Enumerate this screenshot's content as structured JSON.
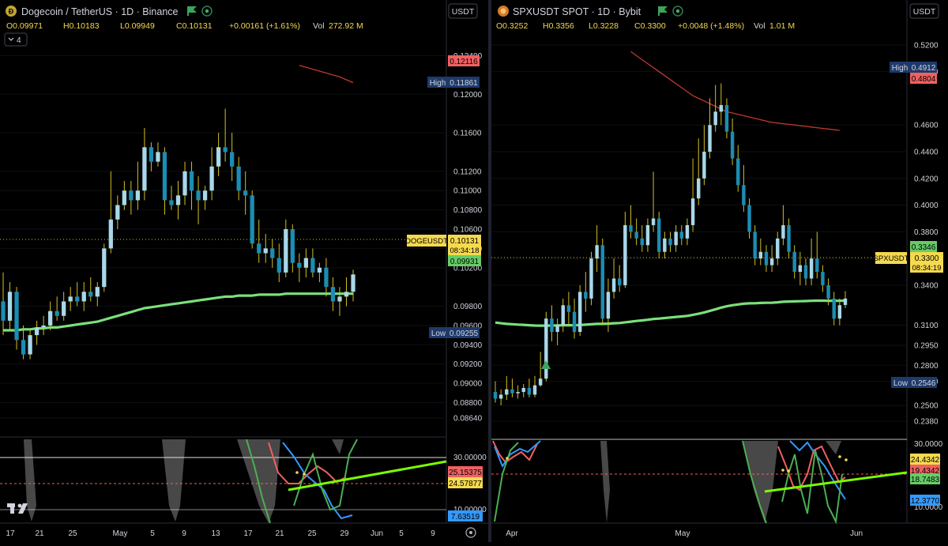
{
  "colors": {
    "bull": "#a8d8ea",
    "bear": "#1b8db3",
    "wick": "#d4c020",
    "ema": "#7be07b",
    "ma_red": "#c0392b",
    "panel_bg": "#000000",
    "border": "#2a2e39",
    "price_text": "#d1d4dc",
    "tag_yellow": "#f5d94e",
    "tag_red": "#f06060",
    "tag_green": "#66cc66",
    "tag_navy": "#1e3a6a",
    "osc_green": "#4caf50",
    "osc_red": "#f06060",
    "osc_blue": "#3399ff",
    "osc_trend": "#7cfc00",
    "osc_gray": "#555555"
  },
  "left": {
    "symbol_icon": "dogecoin-coin-icon",
    "title": "Dogecoin / TetherUS · 1D · Binance",
    "ohlc": {
      "o": "O0.09971",
      "h": "H0.10183",
      "l": "L0.09949",
      "c": "C0.10131",
      "chg": "+0.00161 (+1.61%)",
      "vol_label": "Vol",
      "vol": "272.92 M"
    },
    "collapse_label": "4",
    "currency": "USDT",
    "price_labels": [
      "0.12400",
      "0.12000",
      "0.11600",
      "0.11200",
      "0.11000",
      "0.10800",
      "0.10600",
      "0.10400",
      "0.10200",
      "0.09800",
      "0.09600",
      "0.09400",
      "0.09200",
      "0.09000",
      "0.08800",
      "0.08640"
    ],
    "tags": {
      "ma_red": "0.12116",
      "high_label": "High",
      "high": "0.11861",
      "symbol": "DOGEUSDT",
      "last": "0.10131",
      "countdown": "08:34:18",
      "ema": "0.09931",
      "low_label": "Low",
      "low": "0.09255"
    },
    "osc": {
      "levels": [
        "30.00000",
        "10.00000"
      ],
      "tags": {
        "red": "25.15375",
        "yellow": "24.57877",
        "blue": "7.63519"
      }
    },
    "x_labels": [
      "17",
      "21",
      "25",
      "May",
      "5",
      "9",
      "13",
      "17",
      "21",
      "25",
      "29",
      "Jun",
      "5",
      "9"
    ],
    "logo": "TV"
  },
  "right": {
    "symbol_icon": "spx-coin-icon",
    "title": "SPXUSDT SPOT · 1D · Bybit",
    "ohlc": {
      "o": "O0.3252",
      "h": "H0.3356",
      "l": "L0.3228",
      "c": "C0.3300",
      "chg": "+0.0048 (+1.48%)",
      "vol_label": "Vol",
      "vol": "1.01 M"
    },
    "currency": "USDT",
    "price_labels": [
      "0.5200",
      "0.5000",
      "0.4600",
      "0.4400",
      "0.4200",
      "0.4000",
      "0.3800",
      "0.3600",
      "0.3400",
      "0.3100",
      "0.2950",
      "0.2800",
      "0.2680",
      "0.2500",
      "0.2380"
    ],
    "tags": {
      "high_label": "High",
      "high": "0.4912",
      "ma_red": "0.4804",
      "ema": "0.3346",
      "symbol": "SPXUSDT",
      "last": "0.3300",
      "countdown": "08:34:19",
      "low_label": "Low",
      "low": "0.2546"
    },
    "osc": {
      "levels": [
        "30.0000",
        "10.0000"
      ],
      "tags": {
        "yellow": "24.4342",
        "red": "19.4342",
        "green": "18.7483",
        "blue": "12.3770"
      }
    },
    "x_labels": [
      "Apr",
      "May",
      "Jun"
    ]
  },
  "chart_data": [
    {
      "type": "candlestick",
      "title": "Dogecoin / TetherUS · 1D · Binance",
      "ylim": [
        0.0855,
        0.1265
      ],
      "ohlc": [
        [
          0.0985,
          0.1015,
          0.095,
          0.0965
        ],
        [
          0.0965,
          0.1005,
          0.0955,
          0.0995
        ],
        [
          0.0995,
          0.1,
          0.0935,
          0.0945
        ],
        [
          0.0945,
          0.096,
          0.0925,
          0.093
        ],
        [
          0.093,
          0.0955,
          0.0925,
          0.095
        ],
        [
          0.095,
          0.0965,
          0.094,
          0.0958
        ],
        [
          0.0958,
          0.097,
          0.095,
          0.096
        ],
        [
          0.096,
          0.0985,
          0.0955,
          0.0975
        ],
        [
          0.0975,
          0.099,
          0.0965,
          0.097
        ],
        [
          0.097,
          0.0995,
          0.0965,
          0.0985
        ],
        [
          0.0985,
          0.1,
          0.0975,
          0.099
        ],
        [
          0.099,
          0.1005,
          0.098,
          0.0985
        ],
        [
          0.0985,
          0.1005,
          0.0975,
          0.0995
        ],
        [
          0.0995,
          0.101,
          0.0985,
          0.099
        ],
        [
          0.099,
          0.1005,
          0.098,
          0.1
        ],
        [
          0.1,
          0.1045,
          0.0995,
          0.104
        ],
        [
          0.104,
          0.112,
          0.1035,
          0.107
        ],
        [
          0.107,
          0.1095,
          0.106,
          0.1085
        ],
        [
          0.1085,
          0.111,
          0.108,
          0.11
        ],
        [
          0.11,
          0.111,
          0.1075,
          0.109
        ],
        [
          0.109,
          0.113,
          0.108,
          0.11
        ],
        [
          0.11,
          0.1165,
          0.109,
          0.1145
        ],
        [
          0.1145,
          0.115,
          0.112,
          0.113
        ],
        [
          0.113,
          0.115,
          0.1125,
          0.114
        ],
        [
          0.114,
          0.1145,
          0.1075,
          0.109
        ],
        [
          0.109,
          0.1105,
          0.108,
          0.1085
        ],
        [
          0.1085,
          0.111,
          0.107,
          0.1095
        ],
        [
          0.1095,
          0.113,
          0.1085,
          0.112
        ],
        [
          0.112,
          0.113,
          0.108,
          0.11
        ],
        [
          0.11,
          0.1115,
          0.1065,
          0.109
        ],
        [
          0.109,
          0.1105,
          0.108,
          0.11
        ],
        [
          0.11,
          0.1145,
          0.109,
          0.1125
        ],
        [
          0.1125,
          0.116,
          0.1115,
          0.1145
        ],
        [
          0.1145,
          0.1185,
          0.113,
          0.114
        ],
        [
          0.114,
          0.116,
          0.111,
          0.1125
        ],
        [
          0.1125,
          0.1135,
          0.109,
          0.11
        ],
        [
          0.11,
          0.112,
          0.1075,
          0.1095
        ],
        [
          0.1095,
          0.11,
          0.104,
          0.1045
        ],
        [
          0.1045,
          0.107,
          0.1025,
          0.1035
        ],
        [
          0.1035,
          0.1055,
          0.1025,
          0.104
        ],
        [
          0.104,
          0.105,
          0.102,
          0.103
        ],
        [
          0.103,
          0.1045,
          0.1005,
          0.1015
        ],
        [
          0.1015,
          0.107,
          0.101,
          0.106
        ],
        [
          0.106,
          0.1065,
          0.1015,
          0.1025
        ],
        [
          0.1025,
          0.1035,
          0.1005,
          0.102
        ],
        [
          0.102,
          0.104,
          0.101,
          0.103
        ],
        [
          0.103,
          0.104,
          0.101,
          0.1015
        ],
        [
          0.1015,
          0.1025,
          0.1005,
          0.102
        ],
        [
          0.102,
          0.103,
          0.099,
          0.1
        ],
        [
          0.1,
          0.101,
          0.0975,
          0.0985
        ],
        [
          0.0985,
          0.1,
          0.097,
          0.099
        ],
        [
          0.099,
          0.101,
          0.098,
          0.0995
        ],
        [
          0.0995,
          0.1018,
          0.0985,
          0.1013
        ]
      ],
      "ema": [
        0.0955,
        0.0955,
        0.0955,
        0.0956,
        0.0956,
        0.0957,
        0.0957,
        0.0958,
        0.0958,
        0.0959,
        0.096,
        0.0961,
        0.0962,
        0.0963,
        0.0964,
        0.0966,
        0.0968,
        0.097,
        0.0972,
        0.0974,
        0.0976,
        0.0978,
        0.0979,
        0.098,
        0.0981,
        0.0982,
        0.0983,
        0.0984,
        0.0985,
        0.0986,
        0.0987,
        0.0988,
        0.0989,
        0.099,
        0.099,
        0.0991,
        0.0991,
        0.0991,
        0.0992,
        0.0992,
        0.0992,
        0.0992,
        0.0993,
        0.0993,
        0.0993,
        0.0993,
        0.0993,
        0.0993,
        0.0993,
        0.0993,
        0.0993,
        0.0993,
        0.0993
      ],
      "ma": [
        0.123,
        0.1228,
        0.1226,
        0.1224,
        0.1222,
        0.122,
        0.1218,
        0.1215,
        0.1212
      ],
      "ma_start_index": 44
    },
    {
      "type": "candlestick",
      "title": "SPXUSDT SPOT · 1D · Bybit",
      "ylim": [
        0.234,
        0.53
      ],
      "ohlc": [
        [
          0.26,
          0.268,
          0.252,
          0.255
        ],
        [
          0.255,
          0.262,
          0.25,
          0.258
        ],
        [
          0.258,
          0.272,
          0.254,
          0.262
        ],
        [
          0.262,
          0.27,
          0.256,
          0.259
        ],
        [
          0.259,
          0.265,
          0.255,
          0.26
        ],
        [
          0.26,
          0.266,
          0.256,
          0.263
        ],
        [
          0.263,
          0.27,
          0.256,
          0.258
        ],
        [
          0.258,
          0.272,
          0.256,
          0.265
        ],
        [
          0.265,
          0.29,
          0.264,
          0.27
        ],
        [
          0.27,
          0.32,
          0.268,
          0.315
        ],
        [
          0.315,
          0.325,
          0.298,
          0.305
        ],
        [
          0.305,
          0.315,
          0.295,
          0.31
        ],
        [
          0.31,
          0.33,
          0.305,
          0.325
        ],
        [
          0.325,
          0.335,
          0.31,
          0.32
        ],
        [
          0.32,
          0.33,
          0.3,
          0.305
        ],
        [
          0.305,
          0.34,
          0.302,
          0.335
        ],
        [
          0.335,
          0.35,
          0.32,
          0.33
        ],
        [
          0.33,
          0.365,
          0.325,
          0.36
        ],
        [
          0.36,
          0.385,
          0.35,
          0.37
        ],
        [
          0.37,
          0.375,
          0.31,
          0.315
        ],
        [
          0.315,
          0.345,
          0.305,
          0.335
        ],
        [
          0.335,
          0.36,
          0.33,
          0.345
        ],
        [
          0.345,
          0.355,
          0.335,
          0.34
        ],
        [
          0.34,
          0.395,
          0.338,
          0.385
        ],
        [
          0.385,
          0.4,
          0.375,
          0.38
        ],
        [
          0.38,
          0.39,
          0.37,
          0.375
        ],
        [
          0.375,
          0.385,
          0.365,
          0.37
        ],
        [
          0.37,
          0.39,
          0.365,
          0.385
        ],
        [
          0.385,
          0.425,
          0.38,
          0.39
        ],
        [
          0.39,
          0.395,
          0.36,
          0.365
        ],
        [
          0.365,
          0.38,
          0.36,
          0.375
        ],
        [
          0.375,
          0.38,
          0.365,
          0.37
        ],
        [
          0.37,
          0.385,
          0.365,
          0.38
        ],
        [
          0.38,
          0.385,
          0.37,
          0.375
        ],
        [
          0.375,
          0.39,
          0.37,
          0.385
        ],
        [
          0.385,
          0.435,
          0.38,
          0.405
        ],
        [
          0.405,
          0.45,
          0.4,
          0.42
        ],
        [
          0.42,
          0.46,
          0.415,
          0.44
        ],
        [
          0.44,
          0.48,
          0.435,
          0.46
        ],
        [
          0.46,
          0.49,
          0.455,
          0.47
        ],
        [
          0.47,
          0.4912,
          0.46,
          0.475
        ],
        [
          0.475,
          0.48,
          0.45,
          0.455
        ],
        [
          0.455,
          0.465,
          0.43,
          0.435
        ],
        [
          0.435,
          0.445,
          0.41,
          0.415
        ],
        [
          0.415,
          0.43,
          0.395,
          0.4
        ],
        [
          0.4,
          0.405,
          0.375,
          0.38
        ],
        [
          0.38,
          0.385,
          0.355,
          0.36
        ],
        [
          0.36,
          0.375,
          0.355,
          0.365
        ],
        [
          0.365,
          0.37,
          0.35,
          0.355
        ],
        [
          0.355,
          0.37,
          0.35,
          0.36
        ],
        [
          0.36,
          0.38,
          0.355,
          0.375
        ],
        [
          0.375,
          0.4,
          0.37,
          0.385
        ],
        [
          0.385,
          0.39,
          0.36,
          0.365
        ],
        [
          0.365,
          0.37,
          0.345,
          0.35
        ],
        [
          0.35,
          0.365,
          0.34,
          0.355
        ],
        [
          0.355,
          0.36,
          0.34,
          0.345
        ],
        [
          0.345,
          0.375,
          0.34,
          0.36
        ],
        [
          0.36,
          0.38,
          0.345,
          0.35
        ],
        [
          0.35,
          0.355,
          0.335,
          0.34
        ],
        [
          0.34,
          0.345,
          0.325,
          0.33
        ],
        [
          0.33,
          0.335,
          0.31,
          0.315
        ],
        [
          0.315,
          0.33,
          0.31,
          0.325
        ],
        [
          0.3252,
          0.3356,
          0.3228,
          0.33
        ]
      ],
      "ema": [
        0.312,
        0.3115,
        0.311,
        0.3108,
        0.3105,
        0.3103,
        0.31,
        0.3098,
        0.3097,
        0.3097,
        0.3098,
        0.3099,
        0.31,
        0.31,
        0.31,
        0.3102,
        0.3104,
        0.3107,
        0.311,
        0.311,
        0.3112,
        0.3115,
        0.3117,
        0.3122,
        0.3127,
        0.3132,
        0.3136,
        0.3141,
        0.3147,
        0.315,
        0.3154,
        0.3158,
        0.3162,
        0.3166,
        0.317,
        0.3178,
        0.3186,
        0.3196,
        0.3208,
        0.322,
        0.3232,
        0.3242,
        0.325,
        0.3256,
        0.3261,
        0.3264,
        0.3265,
        0.3267,
        0.3268,
        0.3269,
        0.3272,
        0.3276,
        0.3278,
        0.3279,
        0.328,
        0.3281,
        0.3283,
        0.3284,
        0.3284,
        0.3283,
        0.3283,
        0.3283,
        0.3284
      ],
      "ma": [
        0.515,
        0.512,
        0.509,
        0.506,
        0.503,
        0.5,
        0.497,
        0.494,
        0.491,
        0.488,
        0.485,
        0.482,
        0.48,
        0.478,
        0.476,
        0.474,
        0.472,
        0.47,
        0.469,
        0.468,
        0.467,
        0.466,
        0.465,
        0.464,
        0.463,
        0.462,
        0.4615,
        0.461,
        0.4605,
        0.46,
        0.4595,
        0.459,
        0.4585,
        0.458,
        0.4575,
        0.457,
        0.4565,
        0.456
      ],
      "ma_start_index": 24
    }
  ]
}
